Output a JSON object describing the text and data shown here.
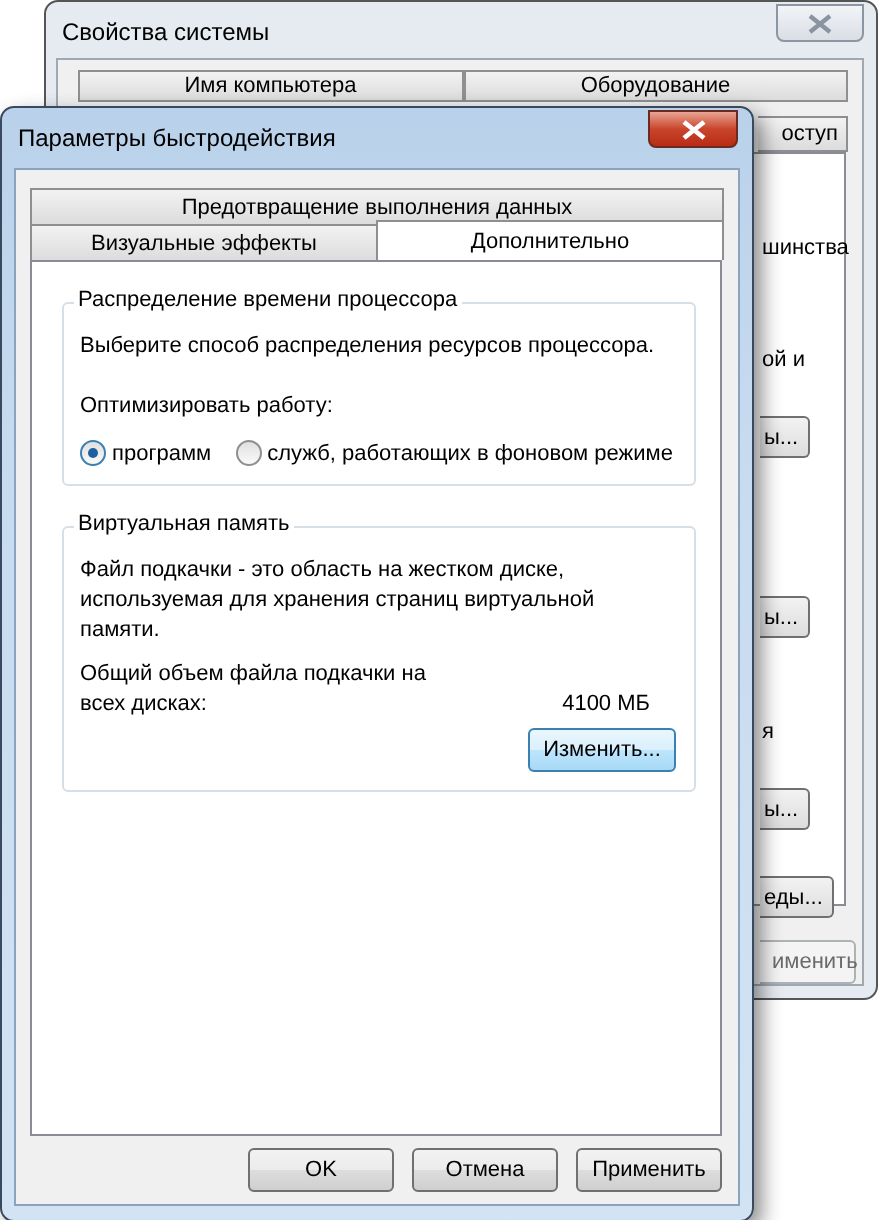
{
  "back_window": {
    "title": "Свойства системы",
    "tab_rows": [
      [
        {
          "label": "Имя компьютера",
          "selected": false
        },
        {
          "label": "Оборудование",
          "selected": false
        }
      ],
      [
        {
          "label": "оступ",
          "selected": false
        }
      ]
    ],
    "fragments": [
      {
        "kind": "text",
        "text": "шинства"
      },
      {
        "kind": "text",
        "text": "ой и"
      },
      {
        "kind": "button",
        "text": "ы..."
      },
      {
        "kind": "button",
        "text": "ы..."
      },
      {
        "kind": "text",
        "text": "я"
      },
      {
        "kind": "button",
        "text": "ы..."
      },
      {
        "kind": "button",
        "text": "еды..."
      }
    ],
    "apply_button": {
      "label": "именить",
      "disabled": true
    }
  },
  "front_window": {
    "title": "Параметры быстродействия",
    "tab_rows": [
      [
        {
          "label": "Предотвращение выполнения данных",
          "selected": false
        }
      ],
      [
        {
          "label": "Визуальные эффекты",
          "selected": false
        },
        {
          "label": "Дополнительно",
          "selected": true
        }
      ]
    ],
    "cpu_group": {
      "title": "Распределение времени процессора",
      "description": "Выберите способ распределения ресурсов процессора.",
      "optimize_label": "Оптимизировать работу:",
      "options": [
        {
          "label": "программ",
          "selected": true
        },
        {
          "label": "служб, работающих в фоновом режиме",
          "selected": false
        }
      ]
    },
    "memory_group": {
      "title": "Виртуальная память",
      "description": "Файл подкачки - это область на жестком диске, используемая для хранения страниц виртуальной памяти.",
      "total_label": "Общий объем файла подкачки на всех дисках:",
      "total_value": "4100 МБ",
      "change_button": "Изменить..."
    },
    "buttons": [
      "OK",
      "Отмена",
      "Применить"
    ]
  }
}
